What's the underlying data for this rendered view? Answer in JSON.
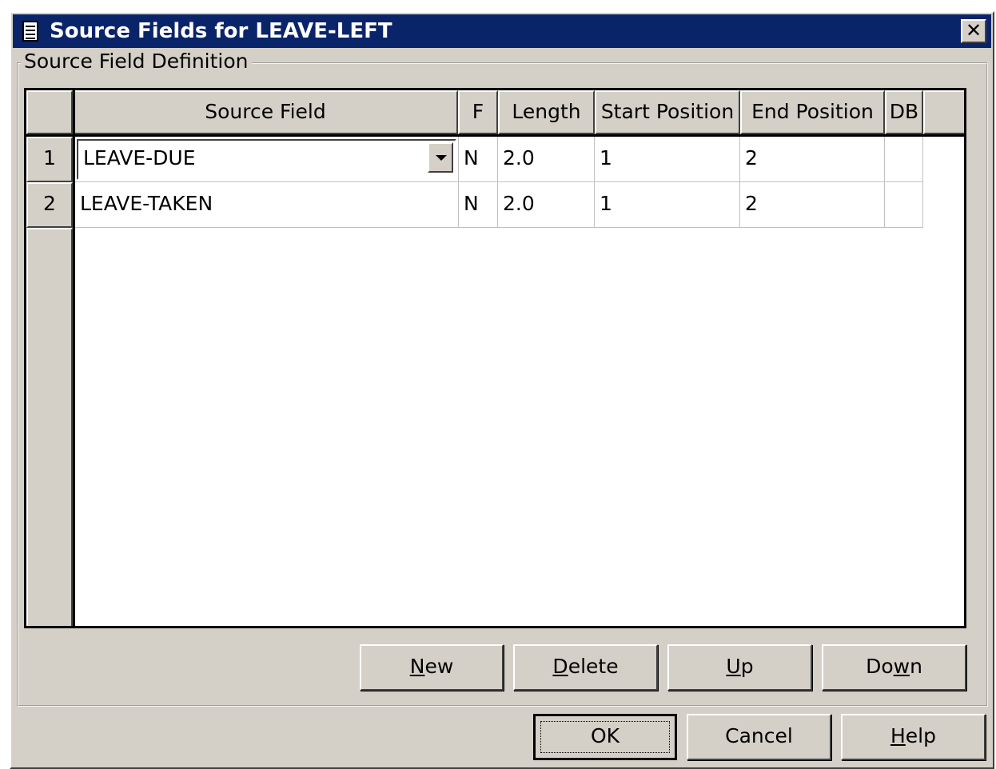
{
  "window": {
    "title": "Source Fields for LEAVE-LEFT",
    "close_label": "✕"
  },
  "group": {
    "label": "Source Field Definition"
  },
  "grid": {
    "headers": {
      "source_field": "Source Field",
      "f": "F",
      "length": "Length",
      "start": "Start Position",
      "end": "End Position",
      "db": "DB"
    },
    "rows": [
      {
        "num": "1",
        "source_field": "LEAVE-DUE",
        "f": "N",
        "length": "2.0",
        "start": "1",
        "end": "2",
        "db": ""
      },
      {
        "num": "2",
        "source_field": "LEAVE-TAKEN",
        "f": "N",
        "length": "2.0",
        "start": "1",
        "end": "2",
        "db": ""
      }
    ]
  },
  "buttons": {
    "new": {
      "hot": "N",
      "rest": "ew"
    },
    "delete": {
      "hot": "D",
      "rest": "elete"
    },
    "up": {
      "hot": "U",
      "rest": "p"
    },
    "down": {
      "pre": "Do",
      "hot": "w",
      "rest": "n"
    },
    "ok": "OK",
    "cancel": "Cancel",
    "help": {
      "hot": "H",
      "rest": "elp"
    }
  },
  "icons": {
    "title": "document-icon",
    "close": "close-icon",
    "dropdown": "chevron-down-icon"
  },
  "colors": {
    "titlebar": "#0a246a",
    "face": "#d4d0c8"
  }
}
